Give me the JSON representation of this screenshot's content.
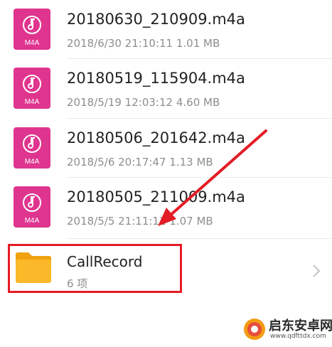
{
  "files": [
    {
      "icon": "audio-m4a-icon",
      "ext": "M4A",
      "name": "20180630_210909.m4a",
      "date": "2018/6/30 21:10:11",
      "size": "1.01 MB"
    },
    {
      "icon": "audio-m4a-icon",
      "ext": "M4A",
      "name": "20180519_115904.m4a",
      "date": "2018/5/19 12:03:12",
      "size": "4.60 MB"
    },
    {
      "icon": "audio-m4a-icon",
      "ext": "M4A",
      "name": "20180506_201642.m4a",
      "date": "2018/5/6 20:17:47",
      "size": "1.13 MB"
    },
    {
      "icon": "audio-m4a-icon",
      "ext": "M4A",
      "name": "20180505_211009.m4a",
      "date": "2018/5/5 21:11:11",
      "size": "1.07 MB"
    }
  ],
  "folder": {
    "icon": "folder-icon",
    "name": "CallRecord",
    "count": "6 项"
  },
  "watermark": {
    "title": "启东安卓网",
    "url": "www.qdfttdx.com"
  },
  "colors": {
    "audio_icon": "#e0358f",
    "folder": "#fbb829",
    "annotation_red": "#e31c25"
  }
}
